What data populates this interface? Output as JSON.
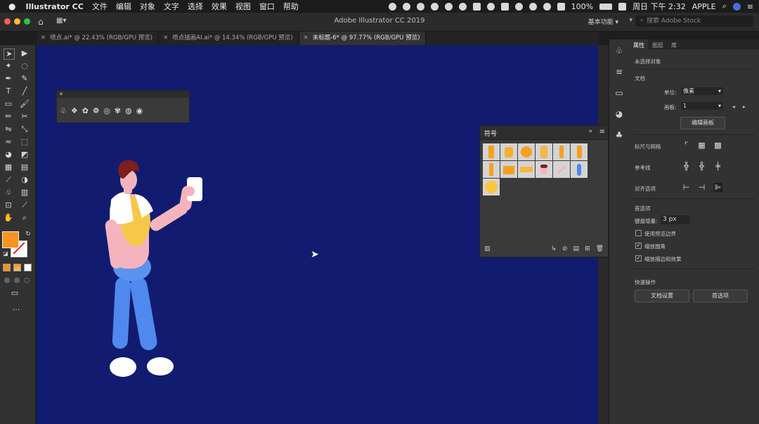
{
  "menubar": {
    "apple": "",
    "app_name": "Illustrator CC",
    "items": [
      "文件",
      "编辑",
      "对象",
      "文字",
      "选择",
      "效果",
      "视图",
      "窗口",
      "帮助"
    ],
    "battery": "100%",
    "clock": "周日 下午 2:32",
    "user": "APPLE"
  },
  "titlebar": {
    "title": "Adobe Illustrator CC 2019",
    "workspace": "基本功能",
    "search_placeholder": "搜索 Adobe Stock"
  },
  "tabs": [
    {
      "label": "喷点.ai* @ 22.43% (RGB/GPU 预览)",
      "active": false
    },
    {
      "label": "喷点插画AI.ai* @ 14.34% (RGB/GPU 预览)",
      "active": false
    },
    {
      "label": "未标题-6* @ 97.77% (RGB/GPU 预览)",
      "active": true
    }
  ],
  "colors": {
    "fill": "#f7931e",
    "canvas": "#111c70"
  },
  "symbols_panel": {
    "title": "符号",
    "count": 13
  },
  "properties": {
    "tabs": [
      "属性",
      "图层",
      "库"
    ],
    "no_selection": "未选择对象",
    "document_section": "文档",
    "units_label": "单位:",
    "units_value": "像素",
    "artboard_label": "画板:",
    "artboard_value": "1",
    "edit_artboards": "编辑画板",
    "rulers_grid": "标尺与网格",
    "guides": "参考线",
    "snap_options": "对齐选项",
    "preferences_section": "首选项",
    "keyboard_increment_label": "键盘增量:",
    "keyboard_increment_value": "3 px",
    "use_preview_bounds": "使用预览边界",
    "scale_corners": "缩放圆角",
    "scale_strokes": "缩放描边和效果",
    "quick_actions": "快速操作",
    "document_setup": "文档设置",
    "preferences_button": "首选项"
  }
}
